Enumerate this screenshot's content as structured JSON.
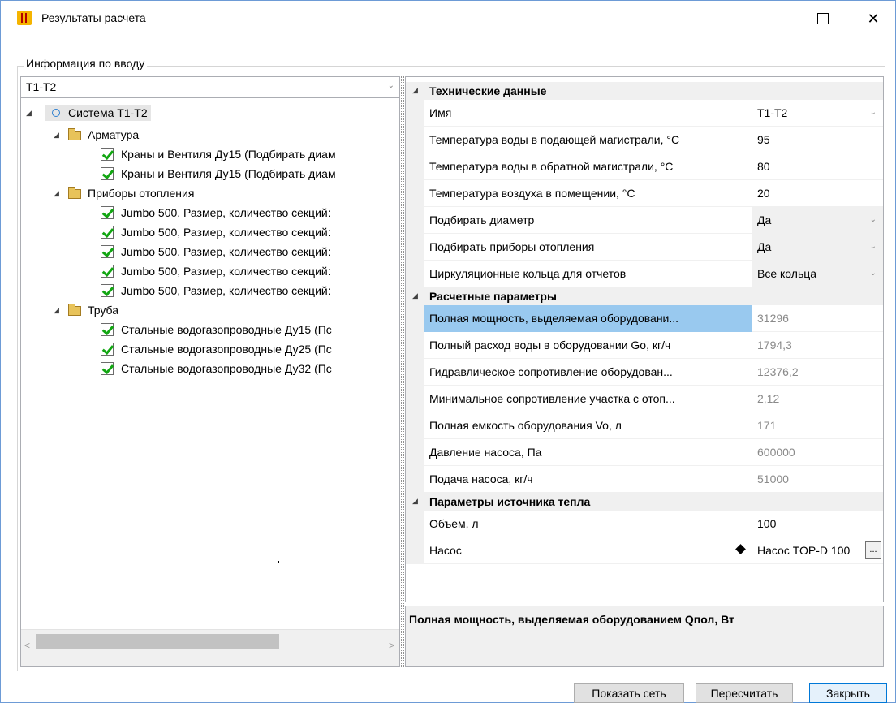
{
  "window": {
    "title": "Результаты расчета"
  },
  "input_group": {
    "label": "Информация по вводу",
    "combo_value": "T1-T2"
  },
  "tree": {
    "root": "Система Т1-Т2",
    "groups": [
      {
        "label": "Арматура",
        "items": [
          "Краны и Вентиля Ду15 (Подбирать диам",
          "Краны и Вентиля Ду15 (Подбирать диам"
        ]
      },
      {
        "label": "Приборы отопления",
        "items": [
          "Jumbo 500, Размер, количество секций:",
          "Jumbo 500, Размер, количество секций:",
          "Jumbo 500, Размер, количество секций:",
          "Jumbo 500, Размер, количество секций:",
          "Jumbo 500, Размер, количество секций:"
        ]
      },
      {
        "label": "Труба",
        "items": [
          "Стальные водогазопроводные Ду15 (Пс",
          "Стальные водогазопроводные Ду25 (Пс",
          "Стальные водогазопроводные Ду32 (Пс"
        ]
      }
    ]
  },
  "properties": {
    "tech": {
      "header": "Технические данные",
      "rows": [
        {
          "name": "Имя",
          "value": "T1-T2"
        },
        {
          "name": "Температура воды в подающей магистрали, °C",
          "value": "95"
        },
        {
          "name": "Температура воды в обратной магистрали, °C",
          "value": "80"
        },
        {
          "name": "Температура воздуха в помещении, °C",
          "value": "20"
        },
        {
          "name": "Подбирать диаметр",
          "value": "Да"
        },
        {
          "name": "Подбирать приборы отопления",
          "value": "Да"
        },
        {
          "name": "Циркуляционные кольца для отчетов",
          "value": "Все кольца"
        }
      ]
    },
    "calc": {
      "header": "Расчетные параметры",
      "rows": [
        {
          "name": "Полная мощность, выделяемая оборудовани...",
          "value": "31296"
        },
        {
          "name": "Полный расход воды в оборудовании Go, кг/ч",
          "value": "1794,3"
        },
        {
          "name": "Гидравлическое сопротивление оборудован...",
          "value": "12376,2"
        },
        {
          "name": "Минимальное сопротивление участка с отоп...",
          "value": "2,12"
        },
        {
          "name": "Полная емкость оборудования Vo, л",
          "value": "171"
        },
        {
          "name": "Давление насоса, Па",
          "value": "600000"
        },
        {
          "name": "Подача насоса, кг/ч",
          "value": "51000"
        }
      ]
    },
    "source": {
      "header": "Параметры источника тепла",
      "rows": [
        {
          "name": "Объем, л",
          "value": "100"
        },
        {
          "name": "Насос",
          "value": "Насос TOP-D 100"
        }
      ]
    }
  },
  "description": "Полная мощность, выделяемая оборудованием Qпол, Вт",
  "buttons": {
    "show_network": "Показать сеть",
    "recalculate": "Пересчитать",
    "close": "Закрыть"
  },
  "icons": {
    "app": "radiator-icon",
    "folder": "folder-icon",
    "check": "checkbox-checked-icon"
  }
}
